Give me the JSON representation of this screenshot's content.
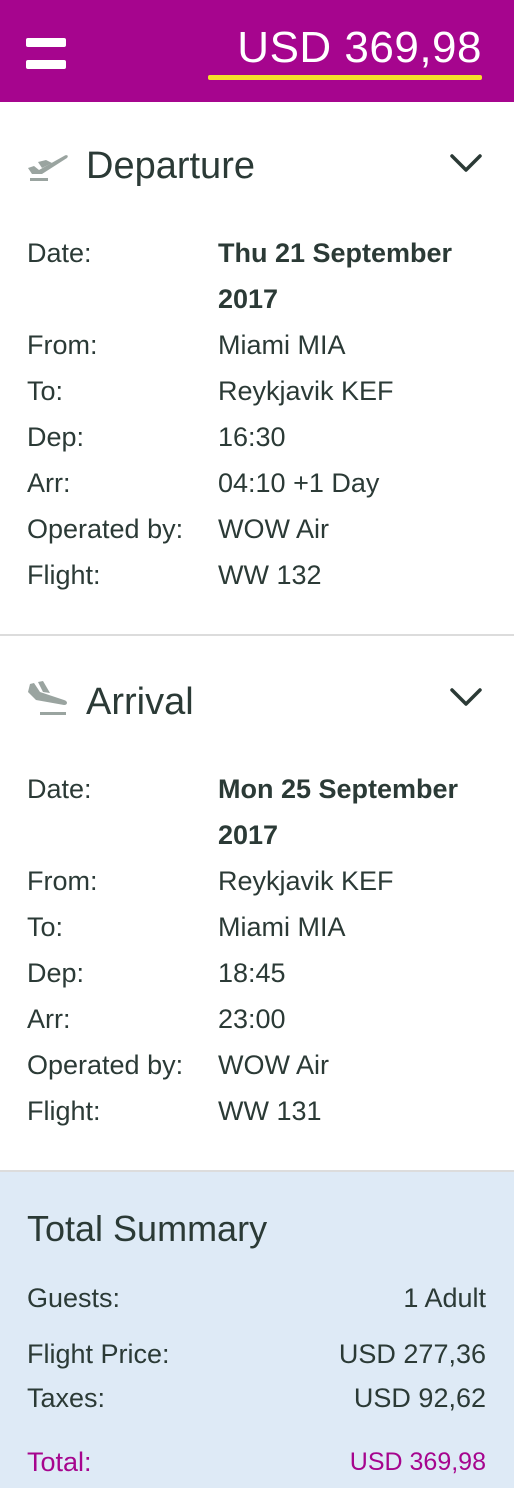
{
  "header": {
    "price": "USD 369,98",
    "colors": {
      "header_bg": "#a6058e",
      "underline": "#f5e02a"
    }
  },
  "departure": {
    "title": "Departure",
    "icon": "plane-takeoff-icon",
    "rows": [
      {
        "label": "Date:",
        "value": "Thu 21 September 2017"
      },
      {
        "label": "From:",
        "value": "Miami MIA"
      },
      {
        "label": "To:",
        "value": "Reykjavik KEF"
      },
      {
        "label": "Dep:",
        "value": "16:30"
      },
      {
        "label": "Arr:",
        "value": "04:10 +1 Day"
      },
      {
        "label": "Operated by:",
        "value": "WOW Air"
      },
      {
        "label": "Flight:",
        "value": "WW 132"
      }
    ]
  },
  "arrival": {
    "title": "Arrival",
    "icon": "plane-landing-icon",
    "rows": [
      {
        "label": "Date:",
        "value": "Mon 25 September 2017"
      },
      {
        "label": "From:",
        "value": "Reykjavik KEF"
      },
      {
        "label": "To:",
        "value": "Miami MIA"
      },
      {
        "label": "Dep:",
        "value": "18:45"
      },
      {
        "label": "Arr:",
        "value": "23:00"
      },
      {
        "label": "Operated by:",
        "value": "WOW Air"
      },
      {
        "label": "Flight:",
        "value": "WW 131"
      }
    ]
  },
  "summary": {
    "title": "Total Summary",
    "guests_label": "Guests:",
    "guests_value": "1 Adult",
    "flight_price_label": "Flight Price:",
    "flight_price_value": "USD 277,36",
    "taxes_label": "Taxes:",
    "taxes_value": "USD 92,62",
    "total_label": "Total:",
    "total_value": "USD 369,98",
    "colors": {
      "bg": "#deeaf6",
      "total": "#a6058e"
    }
  }
}
